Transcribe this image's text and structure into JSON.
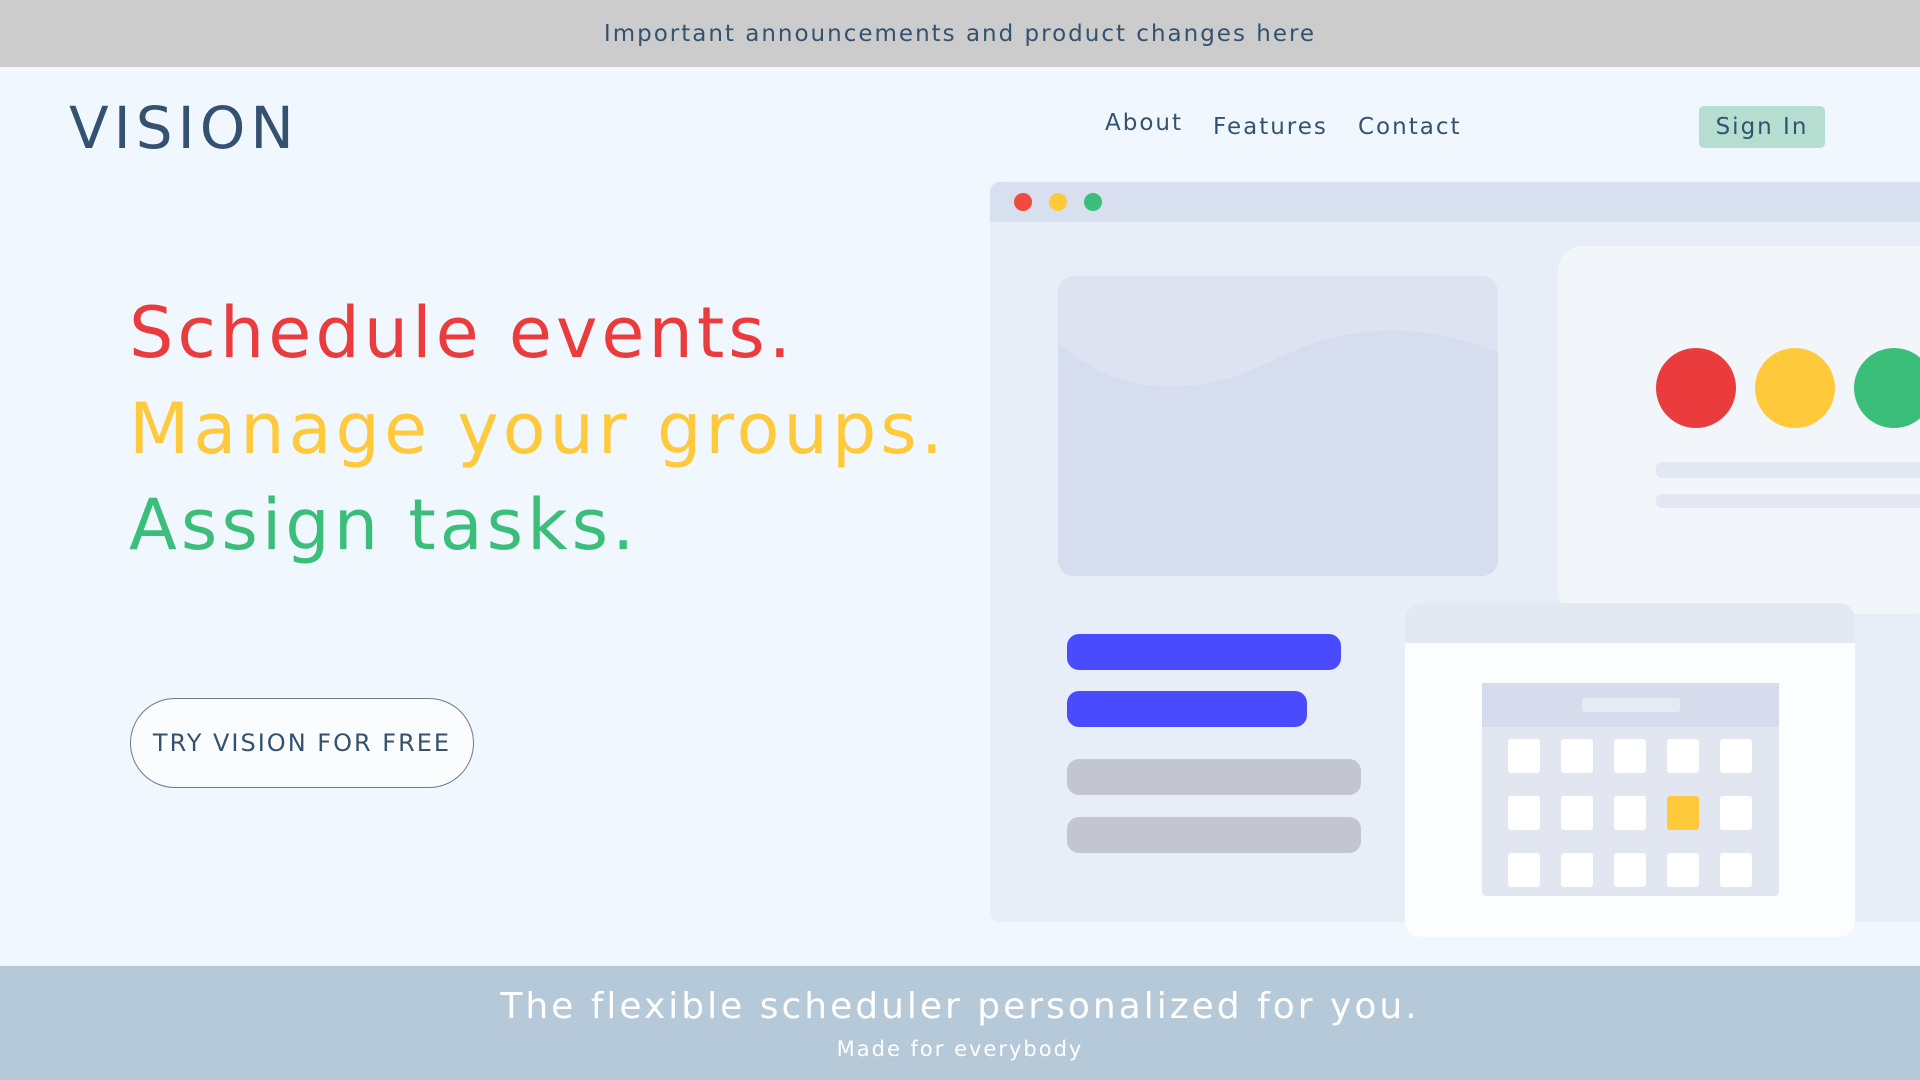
{
  "announcement": "Important announcements and product changes here",
  "brand": "VISION",
  "nav": {
    "about": "About",
    "features": "Features",
    "contact": "Contact",
    "signin": "Sign In"
  },
  "hero": {
    "line1": "Schedule events.",
    "line2": "Manage your groups.",
    "line3": "Assign tasks.",
    "cta": "TRY VISION FOR FREE"
  },
  "footer": {
    "tagline": "The flexible scheduler personalized for you.",
    "subline": "Made for everybody"
  },
  "colors": {
    "red": "#ea3c3c",
    "yellow": "#ffc93c",
    "green": "#3cbe7b",
    "text": "#345270",
    "accent_blue": "#4a4aff",
    "signin_bg": "#b5ddd0"
  },
  "icons": [
    "illustration-traffic-dots",
    "calendar-icon"
  ]
}
